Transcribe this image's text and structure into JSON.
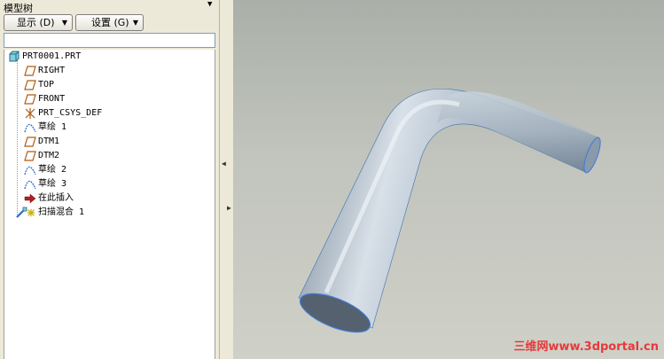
{
  "panel": {
    "title": "模型树",
    "display_button": "显示 (D)",
    "settings_button": "设置 (G)",
    "filter_value": ""
  },
  "tree": {
    "root": "PRT0001.PRT",
    "items": [
      {
        "label": "RIGHT",
        "icon": "datum-plane-icon"
      },
      {
        "label": "TOP",
        "icon": "datum-plane-icon"
      },
      {
        "label": "FRONT",
        "icon": "datum-plane-icon"
      },
      {
        "label": "PRT_CSYS_DEF",
        "icon": "coordinate-system-icon"
      },
      {
        "label": "草绘 1",
        "icon": "sketch-icon"
      },
      {
        "label": "DTM1",
        "icon": "datum-plane-icon"
      },
      {
        "label": "DTM2",
        "icon": "datum-plane-icon"
      },
      {
        "label": "草绘 2",
        "icon": "sketch-icon"
      },
      {
        "label": "草绘 3",
        "icon": "sketch-icon"
      },
      {
        "label": "在此插入",
        "icon": "insert-here-arrow-icon"
      },
      {
        "label": "扫描混合 1",
        "icon": "swept-blend-feature-icon"
      }
    ]
  },
  "watermark": "三维网www.3dportal.cn"
}
